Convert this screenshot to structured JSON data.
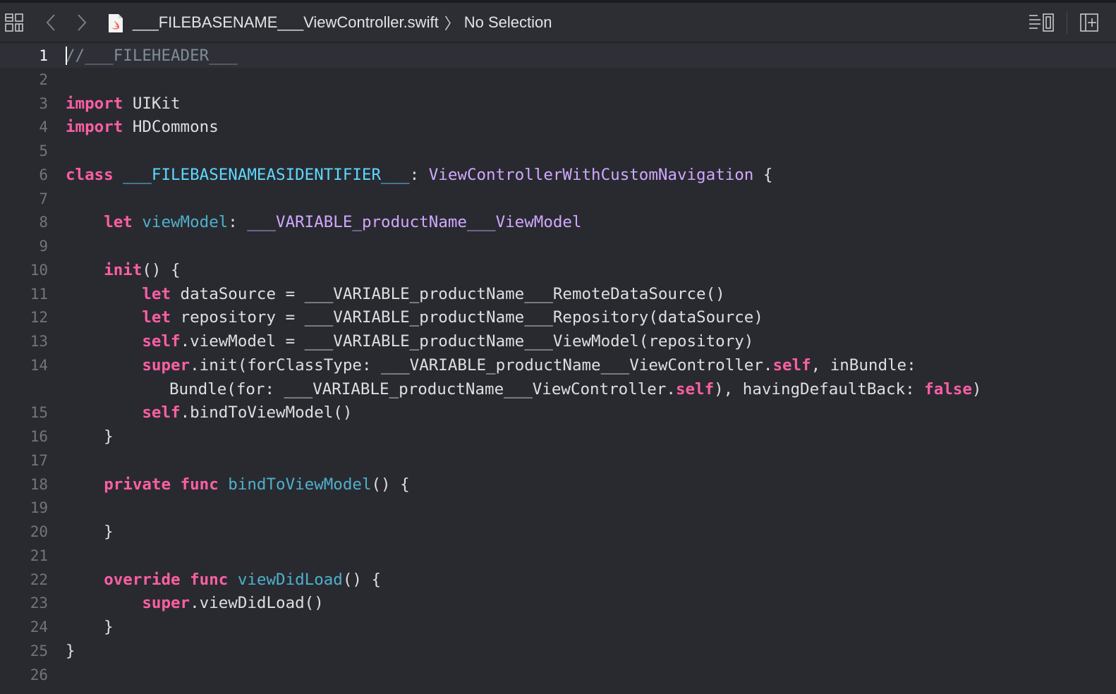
{
  "toolbar": {
    "file_name": "___FILEBASENAME___ViewController.swift",
    "separator": "〉",
    "selection": "No Selection"
  },
  "icons": [
    "grid-icon",
    "back-chevron-icon",
    "forward-chevron-icon",
    "swift-file-icon",
    "editor-options-icon",
    "add-editor-icon"
  ],
  "colors": {
    "background": "#292a30",
    "keyword": "#fc5fa3",
    "type": "#d0a8ff",
    "declaration": "#4eb0cc",
    "comment": "#7f8c98",
    "plain": "#dfdfe0"
  },
  "lines": [
    {
      "n": "1",
      "tokens": [
        {
          "t": "//___FILEHEADER___",
          "c": "cmt"
        }
      ]
    },
    {
      "n": "2",
      "tokens": []
    },
    {
      "n": "3",
      "tokens": [
        {
          "t": "import",
          "c": "kw"
        },
        {
          "t": " UIKit",
          "c": ""
        }
      ]
    },
    {
      "n": "4",
      "tokens": [
        {
          "t": "import",
          "c": "kw"
        },
        {
          "t": " HDCommons",
          "c": ""
        }
      ]
    },
    {
      "n": "5",
      "tokens": []
    },
    {
      "n": "6",
      "tokens": [
        {
          "t": "class",
          "c": "kw"
        },
        {
          "t": " ",
          "c": ""
        },
        {
          "t": "___FILEBASENAMEASIDENTIFIER___",
          "c": "decl"
        },
        {
          "t": ": ",
          "c": ""
        },
        {
          "t": "ViewControllerWithCustomNavigation",
          "c": "typ"
        },
        {
          "t": " {",
          "c": ""
        }
      ]
    },
    {
      "n": "7",
      "tokens": []
    },
    {
      "n": "8",
      "tokens": [
        {
          "t": "    ",
          "c": ""
        },
        {
          "t": "let",
          "c": "kw"
        },
        {
          "t": " ",
          "c": ""
        },
        {
          "t": "viewModel",
          "c": "fn"
        },
        {
          "t": ": ",
          "c": ""
        },
        {
          "t": "___VARIABLE_productName___ViewModel",
          "c": "typ"
        }
      ]
    },
    {
      "n": "9",
      "tokens": []
    },
    {
      "n": "10",
      "tokens": [
        {
          "t": "    ",
          "c": ""
        },
        {
          "t": "init",
          "c": "kw"
        },
        {
          "t": "() {",
          "c": ""
        }
      ]
    },
    {
      "n": "11",
      "tokens": [
        {
          "t": "        ",
          "c": ""
        },
        {
          "t": "let",
          "c": "kw"
        },
        {
          "t": " dataSource = ___VARIABLE_productName___RemoteDataSource()",
          "c": ""
        }
      ]
    },
    {
      "n": "12",
      "tokens": [
        {
          "t": "        ",
          "c": ""
        },
        {
          "t": "let",
          "c": "kw"
        },
        {
          "t": " repository = ___VARIABLE_productName___Repository(dataSource)",
          "c": ""
        }
      ]
    },
    {
      "n": "13",
      "tokens": [
        {
          "t": "        ",
          "c": ""
        },
        {
          "t": "self",
          "c": "kw"
        },
        {
          "t": ".viewModel = ___VARIABLE_productName___ViewModel(repository)",
          "c": ""
        }
      ]
    },
    {
      "n": "14",
      "tokens": [
        {
          "t": "        ",
          "c": ""
        },
        {
          "t": "super",
          "c": "kw"
        },
        {
          "t": ".init(forClassType: ___VARIABLE_productName___ViewController.",
          "c": ""
        },
        {
          "t": "self",
          "c": "kw"
        },
        {
          "t": ", inBundle:",
          "c": ""
        }
      ]
    },
    {
      "n": "",
      "cont": true,
      "tokens": [
        {
          "t": "Bundle(for: ___VARIABLE_productName___ViewController.",
          "c": ""
        },
        {
          "t": "self",
          "c": "kw"
        },
        {
          "t": "), havingDefaultBack: ",
          "c": ""
        },
        {
          "t": "false",
          "c": "kw"
        },
        {
          "t": ")",
          "c": ""
        }
      ]
    },
    {
      "n": "15",
      "tokens": [
        {
          "t": "        ",
          "c": ""
        },
        {
          "t": "self",
          "c": "kw"
        },
        {
          "t": ".bindToViewModel()",
          "c": ""
        }
      ]
    },
    {
      "n": "16",
      "tokens": [
        {
          "t": "    }",
          "c": ""
        }
      ]
    },
    {
      "n": "17",
      "tokens": []
    },
    {
      "n": "18",
      "tokens": [
        {
          "t": "    ",
          "c": ""
        },
        {
          "t": "private",
          "c": "kw"
        },
        {
          "t": " ",
          "c": ""
        },
        {
          "t": "func",
          "c": "kw"
        },
        {
          "t": " ",
          "c": ""
        },
        {
          "t": "bindToViewModel",
          "c": "fn"
        },
        {
          "t": "() {",
          "c": ""
        }
      ]
    },
    {
      "n": "19",
      "tokens": []
    },
    {
      "n": "20",
      "tokens": [
        {
          "t": "    }",
          "c": ""
        }
      ]
    },
    {
      "n": "21",
      "tokens": []
    },
    {
      "n": "22",
      "tokens": [
        {
          "t": "    ",
          "c": ""
        },
        {
          "t": "override",
          "c": "kw"
        },
        {
          "t": " ",
          "c": ""
        },
        {
          "t": "func",
          "c": "kw"
        },
        {
          "t": " ",
          "c": ""
        },
        {
          "t": "viewDidLoad",
          "c": "fn"
        },
        {
          "t": "() {",
          "c": ""
        }
      ]
    },
    {
      "n": "23",
      "tokens": [
        {
          "t": "        ",
          "c": ""
        },
        {
          "t": "super",
          "c": "kw"
        },
        {
          "t": ".viewDidLoad()",
          "c": ""
        }
      ]
    },
    {
      "n": "24",
      "tokens": [
        {
          "t": "    }",
          "c": ""
        }
      ]
    },
    {
      "n": "25",
      "tokens": [
        {
          "t": "}",
          "c": ""
        }
      ]
    },
    {
      "n": "26",
      "tokens": []
    }
  ]
}
